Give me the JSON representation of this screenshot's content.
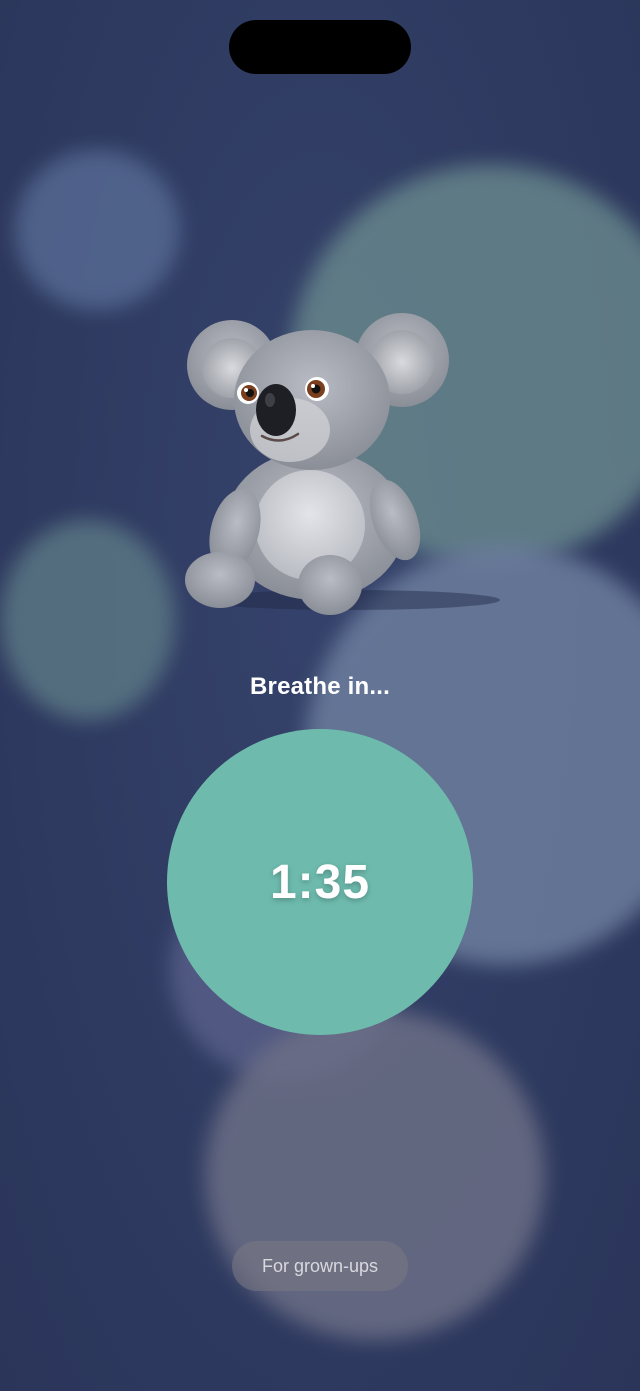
{
  "breathing": {
    "prompt": "Breathe in...",
    "timer": "1:35",
    "accent_color": "#6ebbae"
  },
  "grownups_button": {
    "label": "For grown-ups"
  },
  "mascot": {
    "icon": "koala-plush-illustration"
  }
}
